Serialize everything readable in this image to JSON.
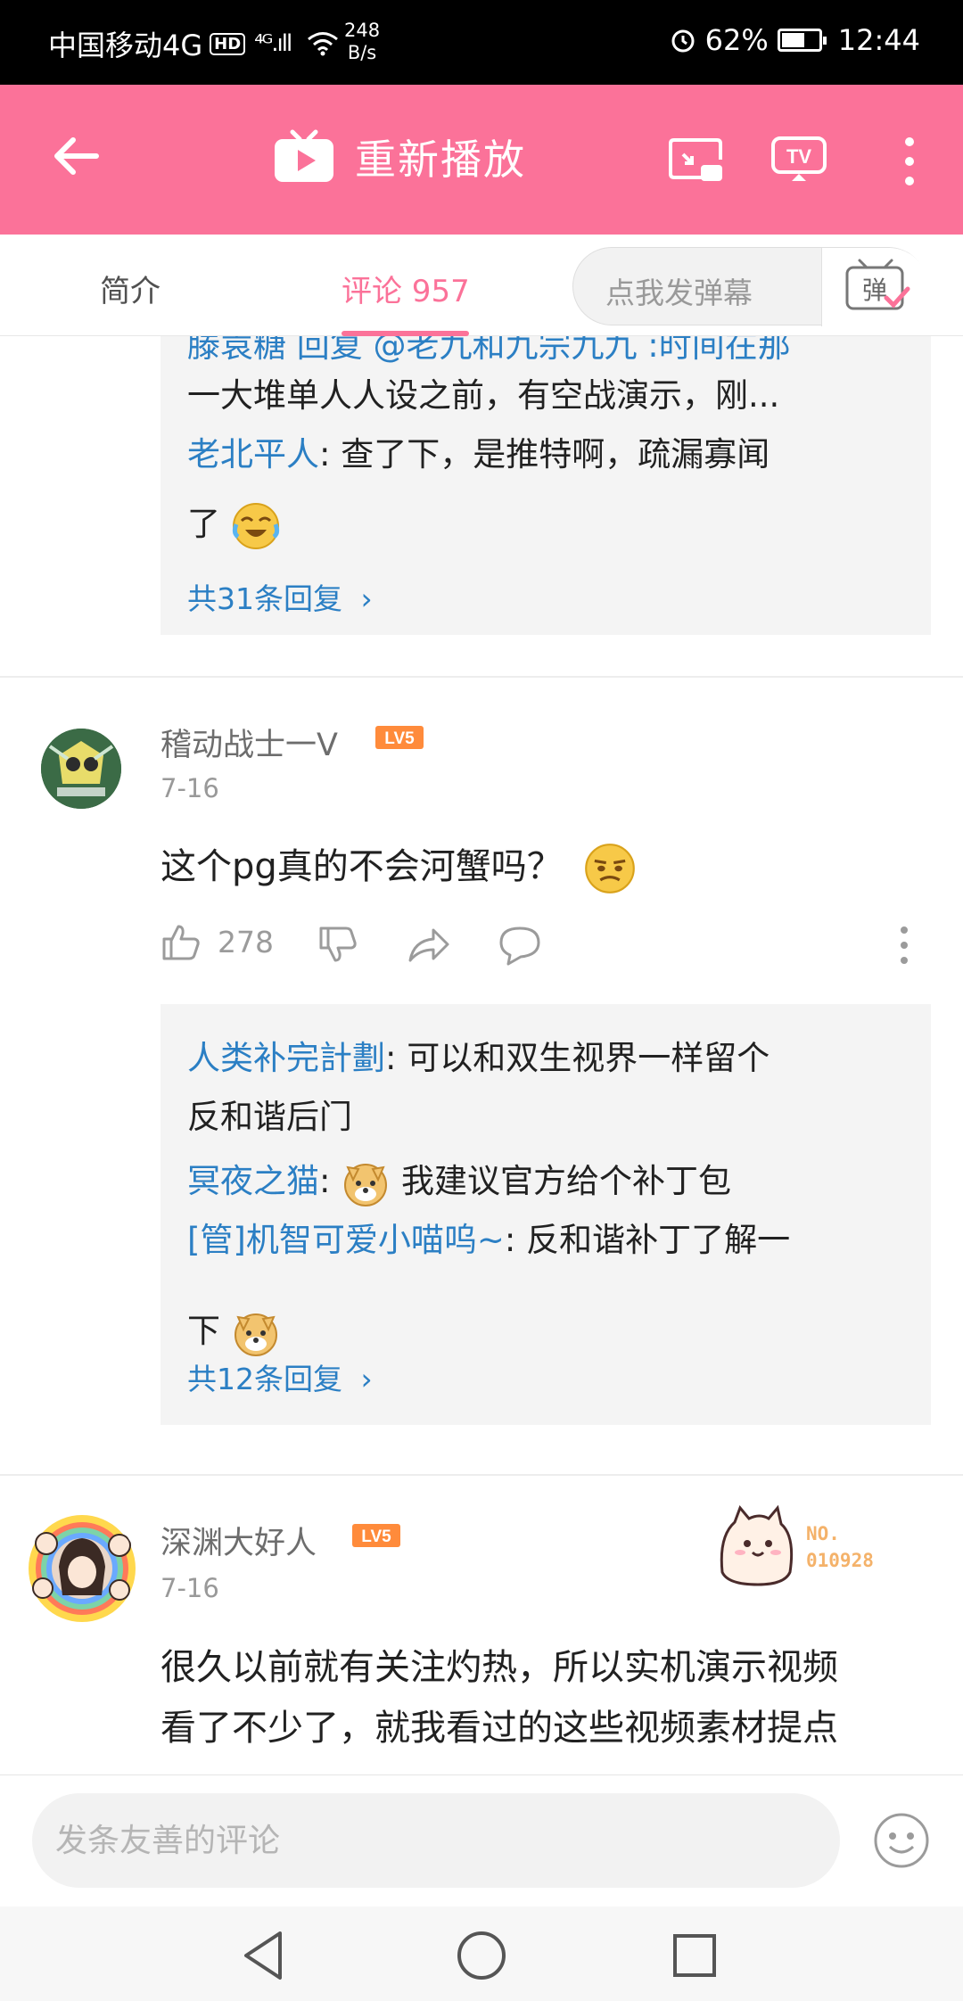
{
  "status_bar": {
    "carrier": "中国移动4G",
    "hd": "HD",
    "signal": "⁴ᴳ.ıll",
    "speed_value": "248",
    "speed_unit": "B/s",
    "battery": "62%",
    "battery_level": 0.62,
    "time": "12:44"
  },
  "header": {
    "title": "重新播放",
    "tv_label": "TV",
    "accent_color": "#fb7299"
  },
  "tabs": {
    "intro": "简介",
    "comments": "评论 957",
    "danmaku_placeholder": "点我发弹幕",
    "danmaku_button": "弹"
  },
  "top_replies": {
    "cut_line": "滕袁糖  回复 @老九和九宗九九 :时间在那",
    "lines": [
      {
        "user": "",
        "text": "一大堆单人人设之前，有空战演示，刚..."
      },
      {
        "user": "老北平人",
        "text": ": 查了下，是推特啊，疏漏寡闻"
      },
      {
        "user": "",
        "text": "了"
      }
    ],
    "more": "共31条回复"
  },
  "comment1": {
    "username": "稽动战士一V",
    "level": "LV5",
    "date": "7-16",
    "text": "这个pg真的不会河蟹吗？",
    "likes": "278",
    "replies": [
      {
        "user": "人类补完計劃",
        "text": ": 可以和双生视界一样留个"
      },
      {
        "user": "",
        "text": "反和谐后门"
      },
      {
        "user": "冥夜之猫",
        "text": ":  我建议官方给个补丁包"
      },
      {
        "user": "[管]机智可爱小喵呜~",
        "text": ": 反和谐补丁了解一"
      },
      {
        "user": "",
        "text": "下"
      }
    ],
    "more": "共12条回复"
  },
  "comment2": {
    "username": "深渊大好人",
    "level": "LV5",
    "date": "7-16",
    "badge_no": "NO.",
    "badge_num": "010928",
    "lines": [
      "很久以前就有关注灼热，所以实机演示视频",
      "看了不少了，就我看过的这些视频素材提点"
    ]
  },
  "comment_bar": {
    "placeholder": "发条友善的评论"
  },
  "icons": {
    "back": "back-arrow-icon",
    "tv": "tv-icon",
    "cast": "cast-icon",
    "tv_cast": "tv-cast-icon",
    "more": "more-vertical-icon",
    "like": "thumbs-up-icon",
    "dislike": "thumbs-down-icon",
    "share": "share-icon",
    "reply": "reply-bubble-icon",
    "face": "emoji-face-icon"
  }
}
